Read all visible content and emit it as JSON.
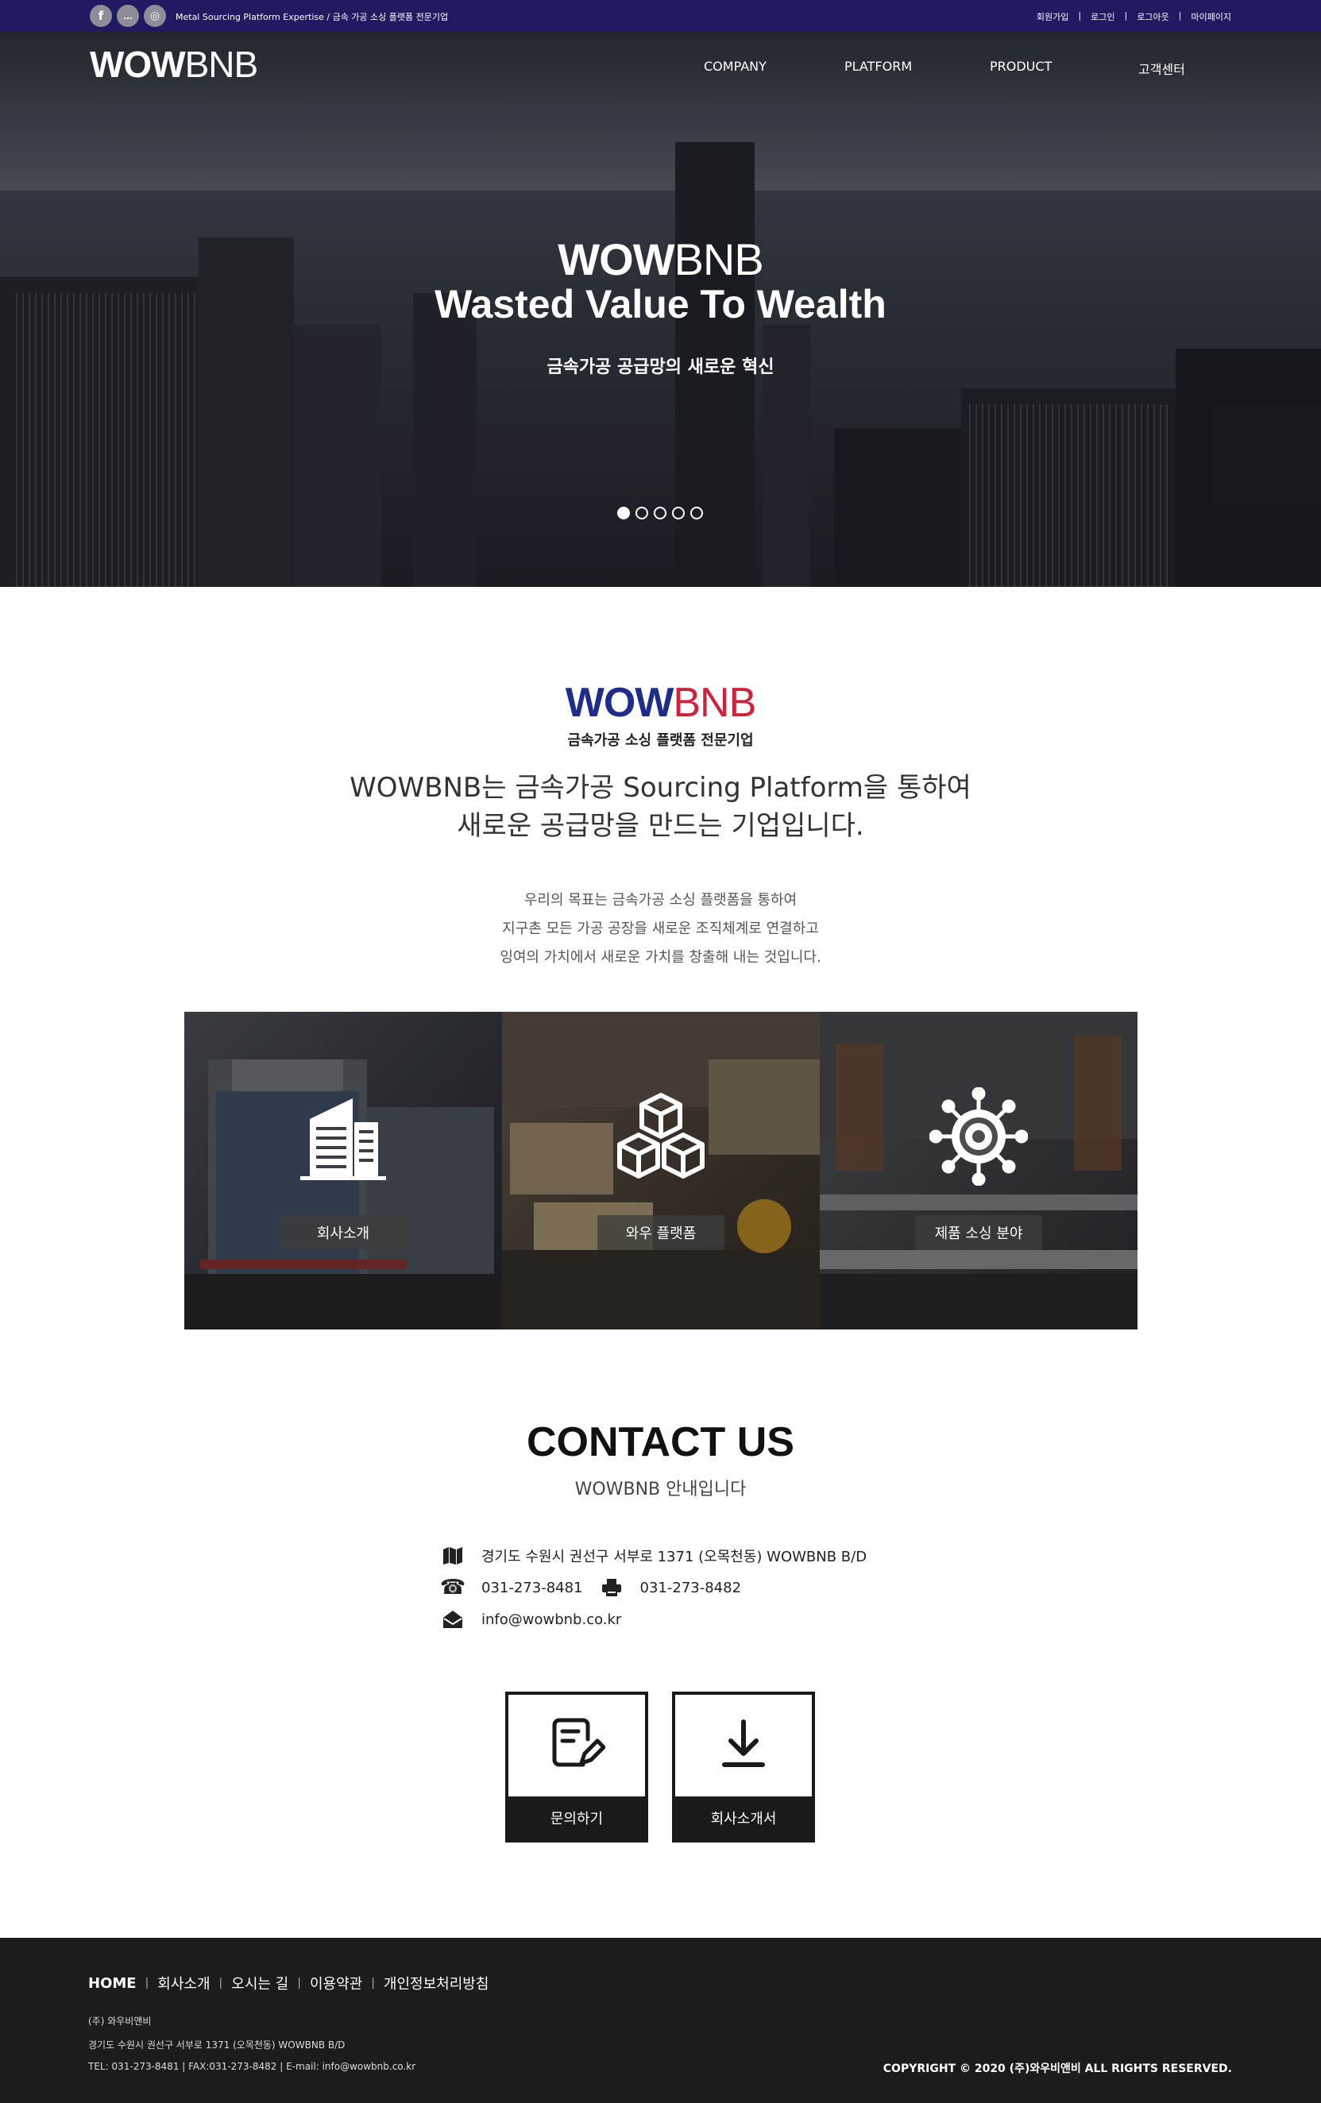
{
  "topbar": {
    "social": [
      {
        "icon": "facebook-icon",
        "glyph": "f"
      },
      {
        "icon": "kakaotalk-icon",
        "glyph": "…"
      },
      {
        "icon": "instagram-icon",
        "glyph": "◎"
      }
    ],
    "tagline": "Metal Sourcing Platform Expertise / 금속 가공 소싱 플랫폼 전문기업",
    "util_links": [
      "회원가입",
      "로그인",
      "로그아웃",
      "마이페이지"
    ]
  },
  "header": {
    "logo_bold": "WOW",
    "logo_light": "BNB",
    "nav": [
      "COMPANY",
      "PLATFORM",
      "PRODUCT",
      "고객센터"
    ]
  },
  "hero": {
    "logo_bold": "WOW",
    "logo_light": "BNB",
    "title": "Wasted Value To Wealth",
    "subtitle": "금속가공 공급망의 새로운 혁신",
    "slide_count": 5,
    "active_slide": 1
  },
  "intro": {
    "brand_bold": "WOW",
    "brand_light": "BNB",
    "brand_colors": {
      "wow": "#1f2d8a",
      "bnb": "#d0203a"
    },
    "subtitle": "금속가공 소싱 플랫폼 전문기업",
    "headline_1": "WOWBNB는 금속가공 Sourcing Platform을 통하여",
    "headline_2": "새로운 공급망을 만드는 기업입니다.",
    "body_1": "우리의 목표는 금속가공 소싱 플랫폼을 통하여",
    "body_2": "지구촌 모든 가공 공장을 새로운 조직체계로 연결하고",
    "body_3": "잉여의 가치에서 새로운 가치를 창출해 내는 것입니다."
  },
  "panels": [
    {
      "label": "회사소개",
      "icon": "building-icon"
    },
    {
      "label": "와우 플랫폼",
      "icon": "cubes-icon"
    },
    {
      "label": "제품 소싱 분야",
      "icon": "gear-network-icon"
    }
  ],
  "contact": {
    "title": "CONTACT US",
    "subtitle": "WOWBNB 안내입니다",
    "address": "경기도 수원시 권선구 서부로 1371 (오목천동) WOWBNB B/D",
    "tel": "031-273-8481",
    "fax": "031-273-8482",
    "email": "info@wowbnb.co.kr",
    "buttons": [
      {
        "label": "문의하기",
        "icon": "inquiry-edit-icon"
      },
      {
        "label": "회사소개서",
        "icon": "download-icon"
      }
    ]
  },
  "footer": {
    "nav": [
      "HOME",
      "회사소개",
      "오시는 길",
      "이용약관",
      "개인정보처리방침"
    ],
    "company": "(주) 와우비앤비",
    "address": "경기도 수원시 권선구 서부로 1371 (오목천동) WOWBNB B/D",
    "contact_line": "TEL: 031-273-8481   |   FAX:031-273-8482   |   E-mail: info@wowbnb.co.kr",
    "copyright": "COPYRIGHT © 2020 (주)와우비앤비 ALL RIGHTS RESERVED."
  }
}
